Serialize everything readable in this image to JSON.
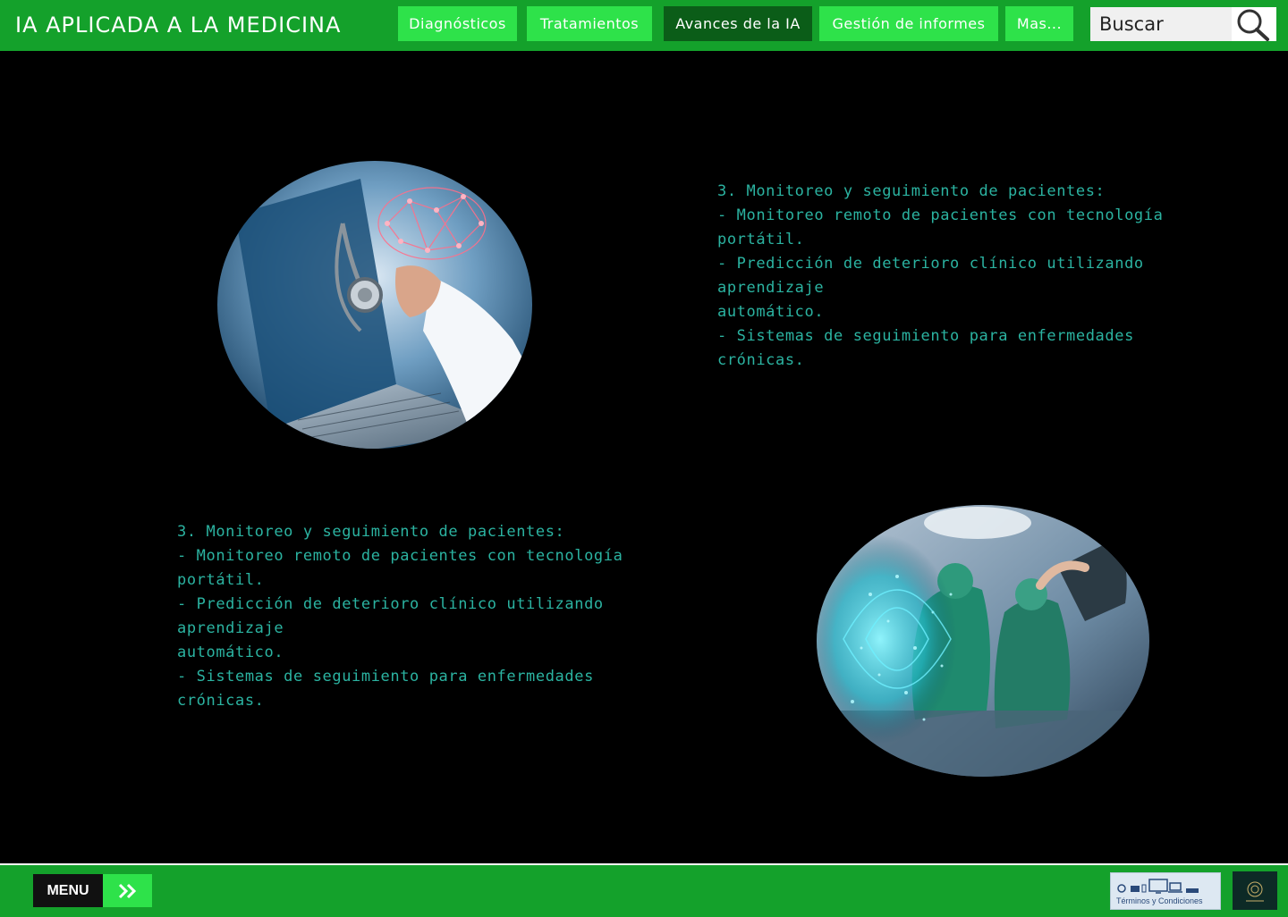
{
  "header": {
    "brand": "IA APLICADA A LA MEDICINA",
    "nav": [
      {
        "label": "Diagnósticos"
      },
      {
        "label": "Tratamientos"
      },
      {
        "label": "Avances de la IA",
        "active": true
      },
      {
        "label": "Gestión de informes"
      },
      {
        "label": "Mas..."
      }
    ],
    "search": {
      "placeholder": "Buscar"
    }
  },
  "sections": [
    {
      "heading": "3. Monitoreo y seguimiento de pacientes:",
      "lines": [
        "- Monitoreo remoto de pacientes con tecnología",
        "portátil.",
        "- Predicción de deterioro clínico utilizando aprendizaje",
        "automático.",
        "- Sistemas de seguimiento para enfermedades",
        "crónicas."
      ],
      "image": "doctor-laptop-brain-photo"
    },
    {
      "heading": "3. Monitoreo y seguimiento de pacientes:",
      "lines": [
        "- Monitoreo remoto de pacientes con tecnología",
        "portátil.",
        "- Predicción de deterioro clínico utilizando aprendizaje",
        "automático.",
        "- Sistemas de seguimiento para enfermedades",
        "crónicas."
      ],
      "image": "surgery-hologram-photo"
    }
  ],
  "footer": {
    "menu_label": "MENU",
    "terms_label": "Términos y Condiciones"
  },
  "colors": {
    "header_green": "#14a12b",
    "nav_green": "#2ee24a",
    "nav_active": "#0b5d18",
    "text_teal": "#2bb3a1",
    "background": "#000000"
  }
}
